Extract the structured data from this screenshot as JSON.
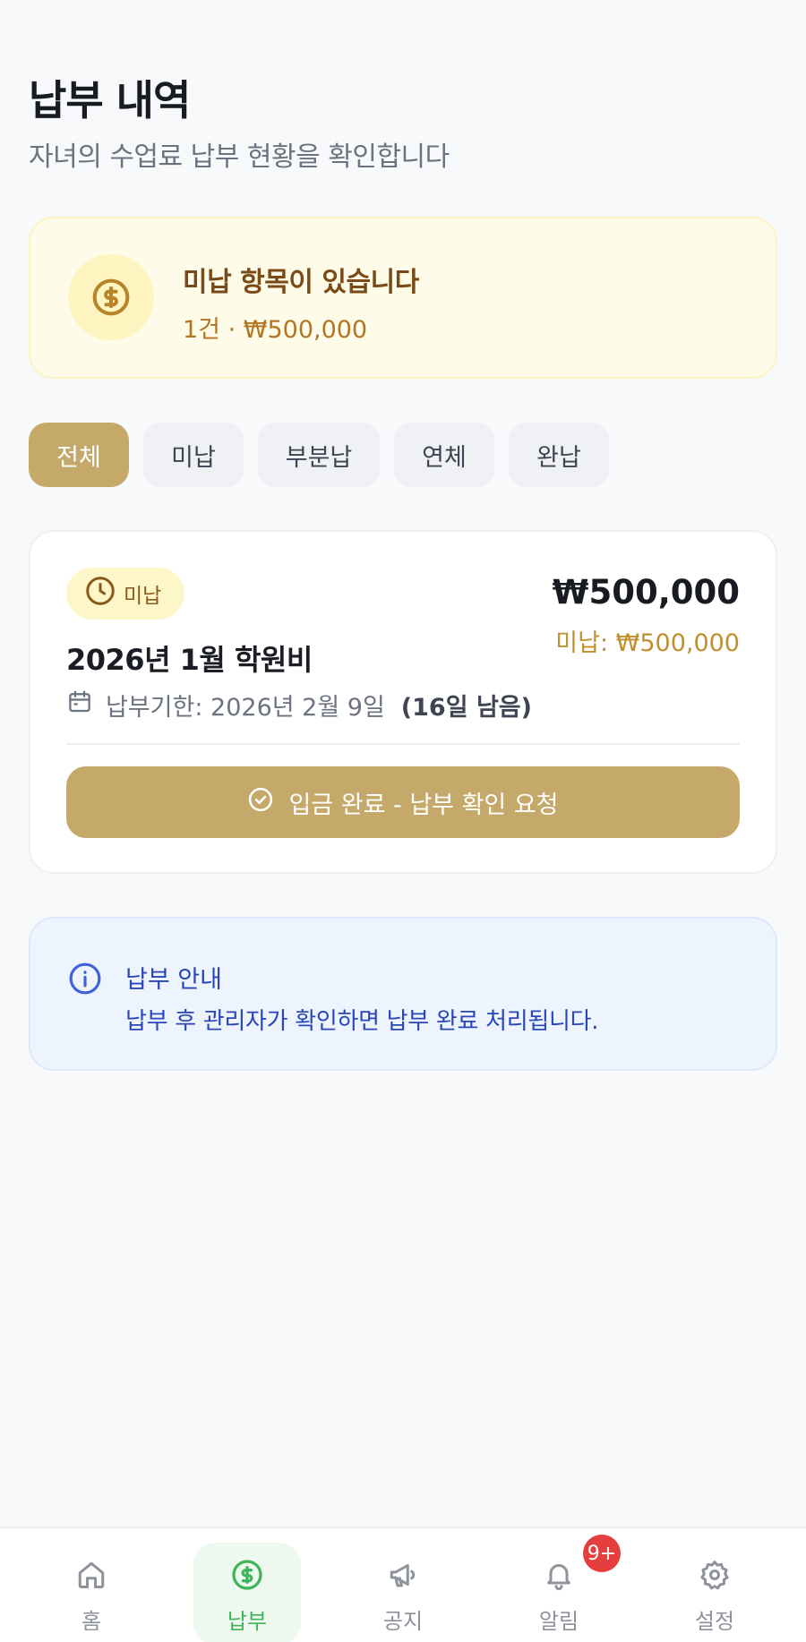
{
  "header": {
    "title": "납부 내역",
    "subtitle": "자녀의 수업료 납부 현황을 확인합니다"
  },
  "alert": {
    "icon": "dollar-coin-icon",
    "title": "미납 항목이 있습니다",
    "summary": "1건 · ₩500,000"
  },
  "filters": [
    {
      "label": "전체",
      "active": true
    },
    {
      "label": "미납",
      "active": false
    },
    {
      "label": "부분납",
      "active": false
    },
    {
      "label": "연체",
      "active": false
    },
    {
      "label": "완납",
      "active": false
    }
  ],
  "payment": {
    "status": "미납",
    "amount": "₩500,000",
    "unpaid": "미납: ₩500,000",
    "title": "2026년 1월 학원비",
    "due": "납부기한: 2026년 2월 9일",
    "remaining": "(16일 남음)",
    "action": "입금 완료 - 납부 확인 요청"
  },
  "info": {
    "title": "납부 안내",
    "text": "납부 후 관리자가 확인하면 납부 완료 처리됩니다."
  },
  "tabbar": {
    "items": [
      {
        "label": "홈",
        "icon": "home-icon"
      },
      {
        "label": "납부",
        "icon": "dollar-icon",
        "active": true
      },
      {
        "label": "공지",
        "icon": "megaphone-icon"
      },
      {
        "label": "알림",
        "icon": "bell-icon"
      },
      {
        "label": "설정",
        "icon": "gear-icon"
      }
    ],
    "notification_badge": "9+"
  },
  "colors": {
    "accent": "#c4a96a",
    "active_tab": "#3fb45a",
    "badge": "#e53e3e"
  }
}
